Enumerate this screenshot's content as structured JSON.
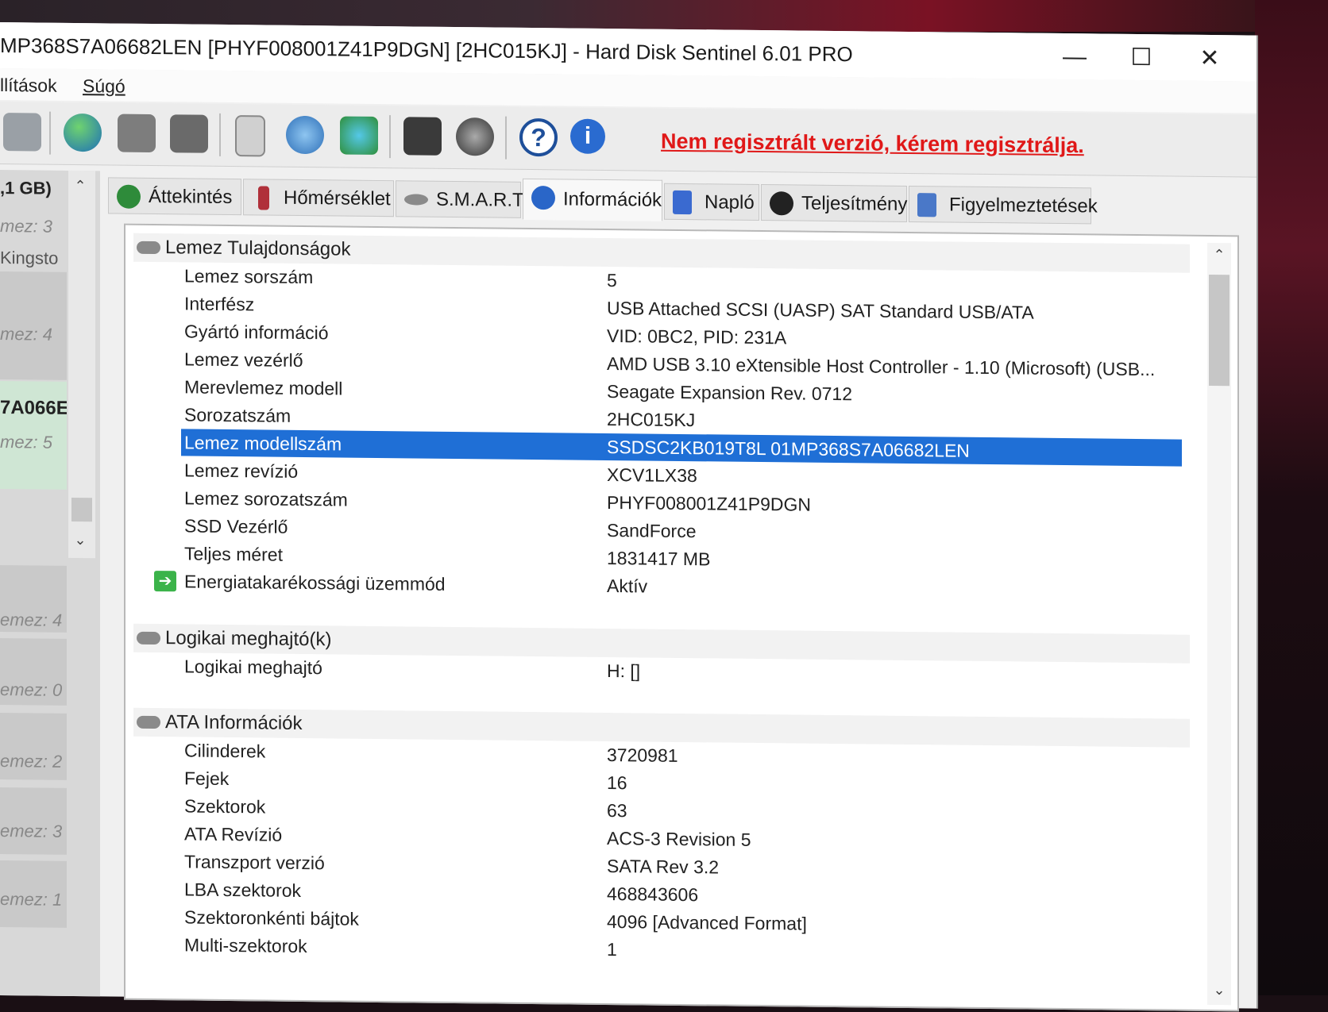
{
  "window": {
    "title": "MP368S7A06682LEN [PHYF008001Z41P9DGN]  [2HC015KJ] -  Hard Disk Sentinel 6.01 PRO",
    "minimize": "—",
    "maximize": "☐",
    "close": "✕"
  },
  "menu": {
    "items": [
      "llítások",
      "Súgó"
    ]
  },
  "toolbar": {
    "register_text": "Nem regisztrált verzió, kérem regisztrálja."
  },
  "left_panel": {
    "size_label": ",1 GB)",
    "items": [
      "mez: 3",
      "Kingsto",
      "mez: 4",
      "7A066E",
      "mez: 5",
      "emez: 4",
      "emez: 0",
      "emez: 2",
      "emez: 3",
      "emez: 1"
    ]
  },
  "tabs": [
    {
      "label": "Áttekintés",
      "color": "#2e8b3a"
    },
    {
      "label": "Hőmérséklet",
      "color": "#b0303a"
    },
    {
      "label": "S.M.A.R.T.",
      "color": "#8a8a8a"
    },
    {
      "label": "Információk",
      "color": "#2a66c8"
    },
    {
      "label": "Napló",
      "color": "#3a6ad0"
    },
    {
      "label": "Teljesítmény",
      "color": "#222222"
    },
    {
      "label": "Figyelmeztetések",
      "color": "#4a78c8"
    }
  ],
  "sections": [
    {
      "title": "Lemez Tulajdonságok",
      "rows": [
        {
          "label": "Lemez sorszám",
          "value": "5"
        },
        {
          "label": "Interfész",
          "value": "USB Attached SCSI (UASP) SAT Standard USB/ATA"
        },
        {
          "label": "Gyártó információ",
          "value": "VID: 0BC2, PID: 231A"
        },
        {
          "label": "Lemez vezérlő",
          "value": "AMD USB 3.10 eXtensible Host Controller - 1.10 (Microsoft) (USB..."
        },
        {
          "label": "Merevlemez modell",
          "value": "Seagate Expansion  Rev. 0712"
        },
        {
          "label": "Sorozatszám",
          "value": "2HC015KJ"
        },
        {
          "label": "Lemez modellszám",
          "value": "SSDSC2KB019T8L      01MP368S7A06682LEN"
        },
        {
          "label": "Lemez revízió",
          "value": "XCV1LX38"
        },
        {
          "label": "Lemez sorozatszám",
          "value": "PHYF008001Z41P9DGN"
        },
        {
          "label": "SSD Vezérlő",
          "value": "SandForce"
        },
        {
          "label": "Teljes méret",
          "value": "1831417 MB"
        },
        {
          "label": "Energiatakarékossági üzemmód",
          "value": "Aktív"
        }
      ]
    },
    {
      "title": "Logikai meghajtó(k)",
      "rows": [
        {
          "label": "Logikai meghajtó",
          "value": "H: []"
        }
      ]
    },
    {
      "title": "ATA Információk",
      "rows": [
        {
          "label": "Cilinderek",
          "value": "3720981"
        },
        {
          "label": "Fejek",
          "value": "16"
        },
        {
          "label": "Szektorok",
          "value": "63"
        },
        {
          "label": "ATA Revízió",
          "value": "ACS-3 Revision 5"
        },
        {
          "label": "Transzport verzió",
          "value": "SATA Rev 3.2"
        },
        {
          "label": "LBA szektorok",
          "value": "468843606"
        },
        {
          "label": "Szektoronkénti bájtok",
          "value": "4096 [Advanced Format]"
        },
        {
          "label": "Multi-szektorok",
          "value": "1"
        }
      ]
    }
  ],
  "colors": {
    "selection": "#1f6fd6",
    "register_link": "#e01818"
  }
}
